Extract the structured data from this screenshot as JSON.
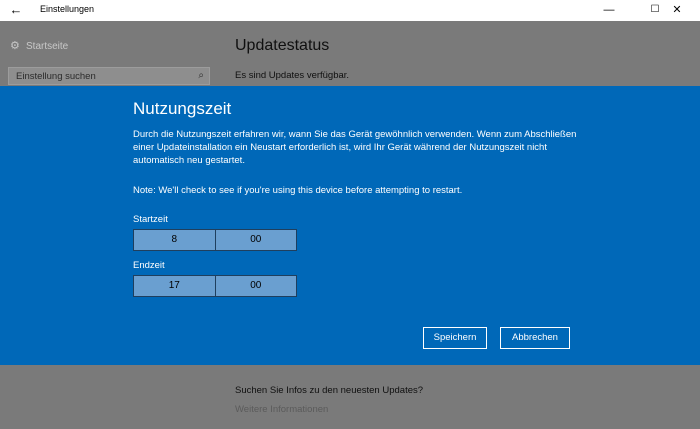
{
  "window": {
    "back_glyph": "←",
    "title": "Einstellungen",
    "minimize_glyph": "—",
    "maximize_glyph": "☐",
    "close_glyph": "✕"
  },
  "sidebar": {
    "home_label": "Startseite",
    "home_icon": "gear-icon",
    "search_placeholder": "Einstellung suchen",
    "search_icon": "search-icon"
  },
  "main": {
    "title": "Updatestatus",
    "status_text": "Es sind Updates verfügbar.",
    "info_question": "Suchen Sie Infos zu den neuesten Updates?",
    "info_link": "Weitere Informationen"
  },
  "dialog": {
    "title": "Nutzungszeit",
    "body": "Durch die Nutzungszeit erfahren wir, wann Sie das Gerät gewöhnlich verwenden. Wenn zum Abschließen einer Updateinstallation ein Neustart erforderlich ist, wird Ihr Gerät während der Nutzungszeit nicht automatisch neu gestartet.",
    "note": "Note: We'll check to see if you're using this device before attempting to restart.",
    "start_label": "Startzeit",
    "start_hour": "8",
    "start_minute": "00",
    "end_label": "Endzeit",
    "end_hour": "17",
    "end_minute": "00",
    "save_label": "Speichern",
    "cancel_label": "Abbrechen"
  },
  "colors": {
    "dialog_bg": "#0068b8",
    "time_field_bg": "#6a9fd0",
    "overlay_bg": "#7a7a7a"
  }
}
